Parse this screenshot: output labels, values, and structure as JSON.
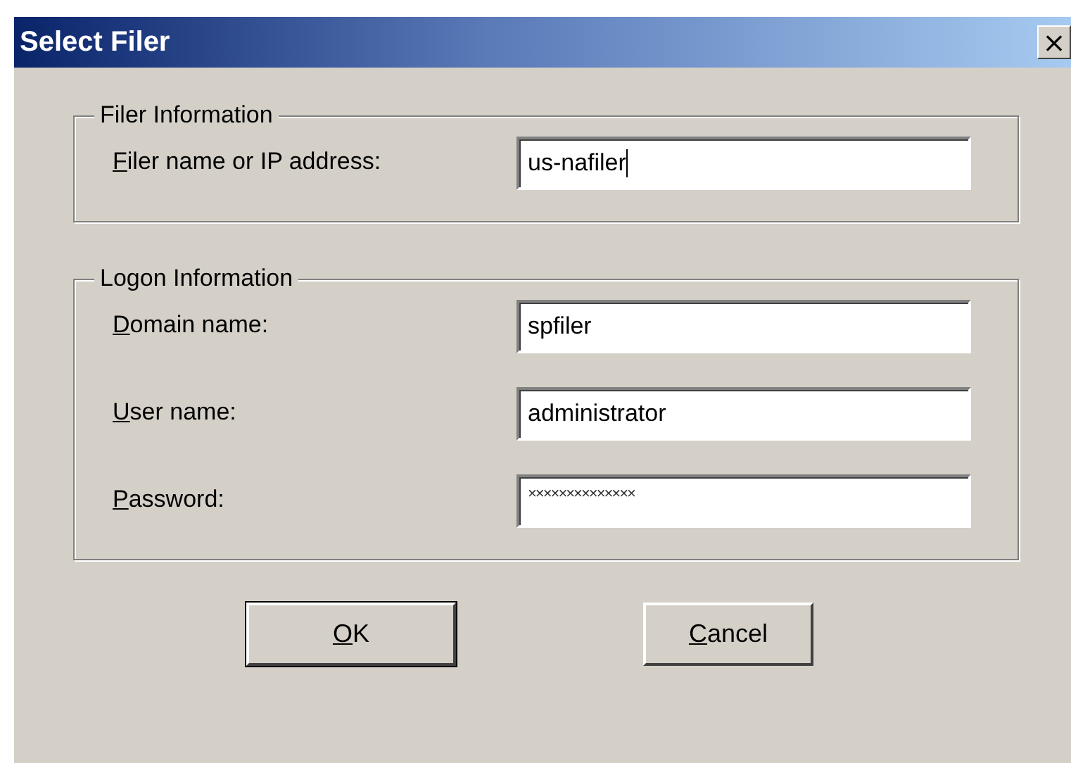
{
  "window": {
    "title": "Select Filer",
    "close_label": "×"
  },
  "groups": [
    {
      "title": "Filer Information",
      "fields": [
        {
          "label": "Filer name or IP address:",
          "underline_first": true,
          "value": "us-nafiler",
          "kind": "text",
          "focused": true
        }
      ]
    },
    {
      "title": "Logon Information",
      "fields": [
        {
          "label": "Domain name:",
          "underline_first": true,
          "value": "spfiler",
          "kind": "text",
          "focused": false
        },
        {
          "label": "User name:",
          "underline_first": true,
          "value": "administrator",
          "kind": "text",
          "focused": false
        },
        {
          "label": "Password:",
          "underline_first": true,
          "value": "××××××××××××××",
          "kind": "password",
          "focused": false
        }
      ]
    }
  ],
  "buttons": [
    {
      "label": "OK",
      "underline_first": true,
      "default": true
    },
    {
      "label": "Cancel",
      "underline_first": true,
      "default": false
    }
  ]
}
